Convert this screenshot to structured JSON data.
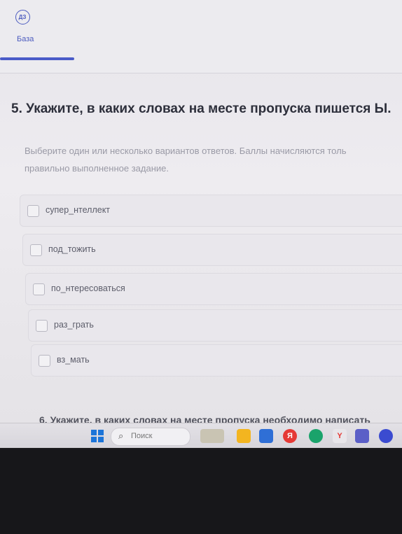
{
  "nav": {
    "badge": "ДЗ",
    "label": "База"
  },
  "question": {
    "title": "5. Укажите, в каких словах на месте пропуска пишется Ы.",
    "instructions_line1": "Выберите один или несколько вариантов ответов. Баллы начисляются толь",
    "instructions_line2": "правильно выполненное задание."
  },
  "options": [
    {
      "label": "супер_нтеллект",
      "checked": false
    },
    {
      "label": "под_тожить",
      "checked": false
    },
    {
      "label": "по_нтересоваться",
      "checked": false
    },
    {
      "label": "раз_грать",
      "checked": false
    },
    {
      "label": "вз_мать",
      "checked": false
    }
  ],
  "next_question": "6. Укажите, в каких словах на месте пропуска необходимо написать",
  "taskbar": {
    "search_placeholder": "Поиск",
    "apps": [
      "file-explorer-icon",
      "office-icon",
      "yandex-icon",
      "edge-icon",
      "yandex-browser-icon",
      "teams-icon",
      "cortana-icon"
    ]
  }
}
